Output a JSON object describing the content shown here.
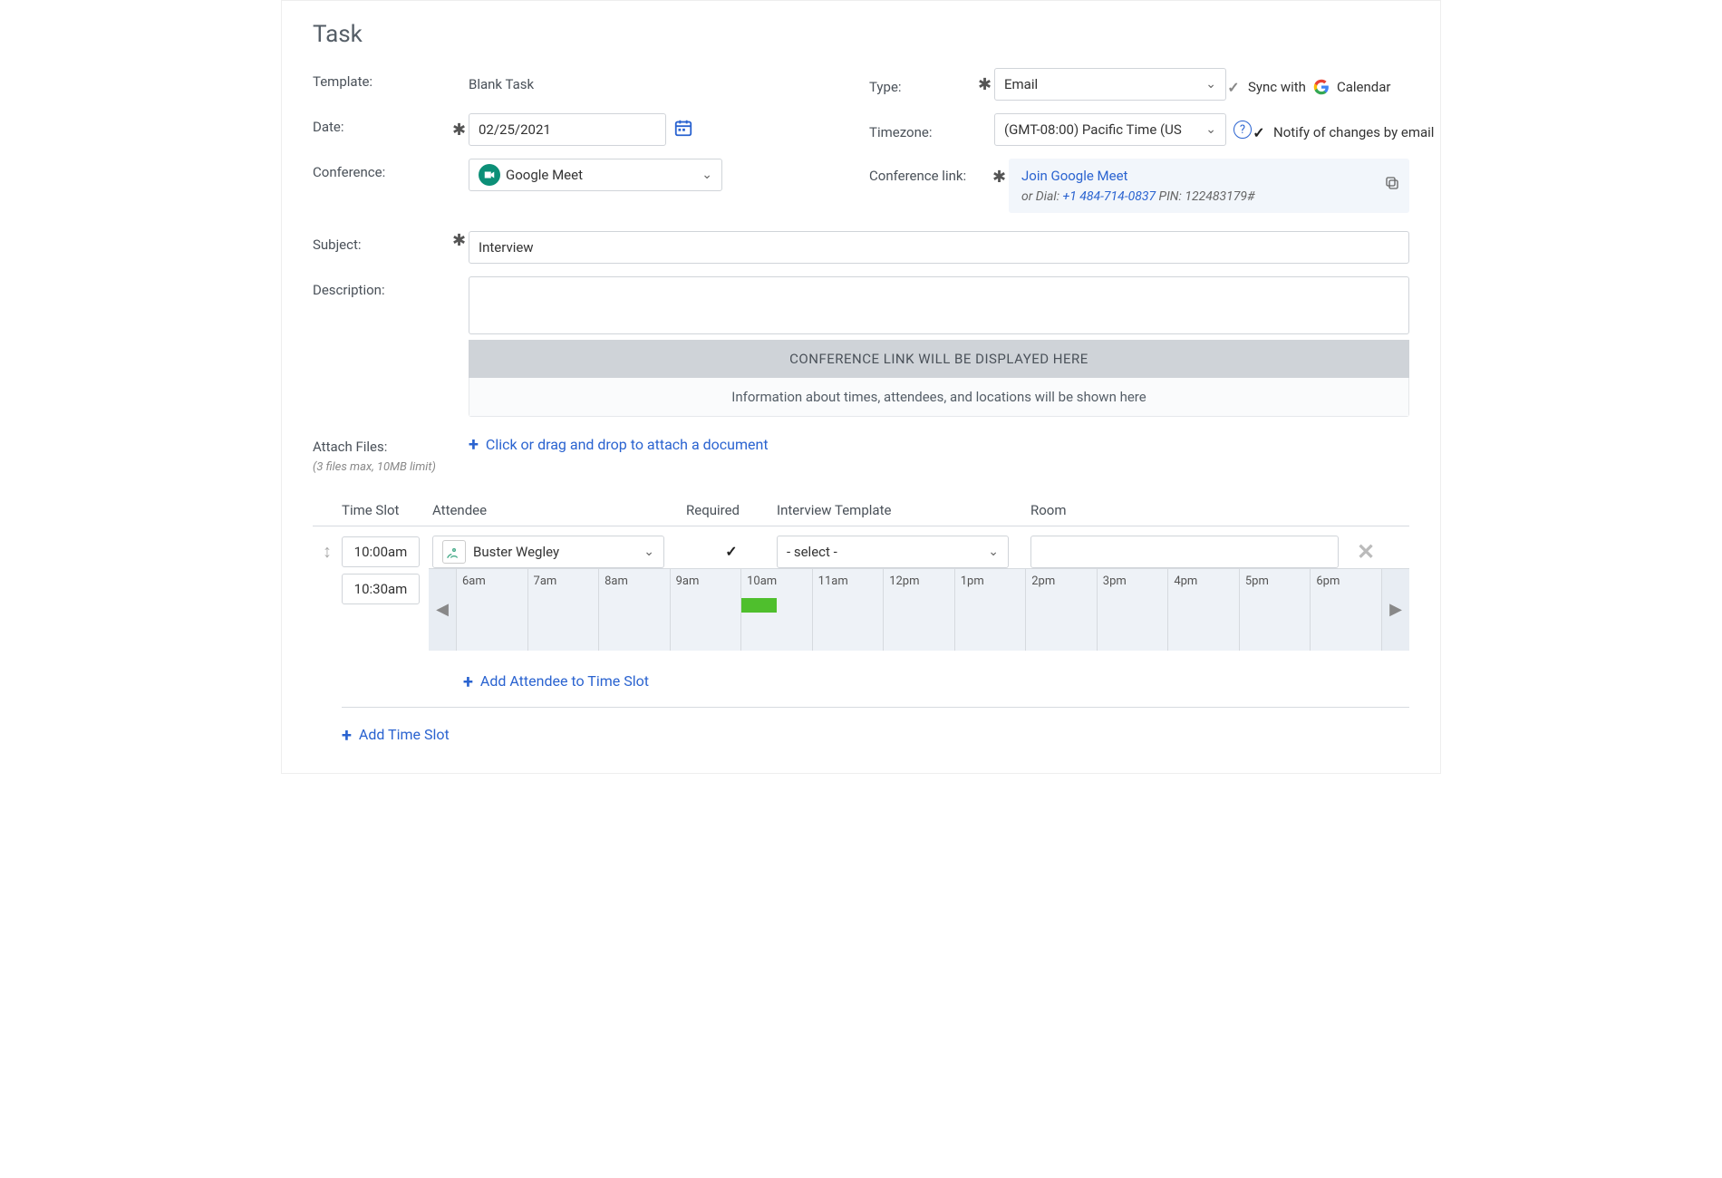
{
  "title": "Task",
  "labels": {
    "template": "Template:",
    "type": "Type:",
    "date": "Date:",
    "timezone": "Timezone:",
    "conference": "Conference:",
    "conference_link": "Conference link:",
    "subject": "Subject:",
    "description": "Description:",
    "attach": "Attach Files:",
    "attach_sub": "(3 files max,\n10MB limit)",
    "sync": "Sync with",
    "calendar": "Calendar",
    "notify": "Notify of changes by email"
  },
  "template_value": "Blank Task",
  "type_value": "Email",
  "date_value": "02/25/2021",
  "timezone_value": "(GMT-08:00) Pacific Time (US",
  "conference_value": "Google Meet",
  "conf_link": {
    "join": "Join Google Meet",
    "or_dial": "or Dial:",
    "phone": "+1 484-714-0837",
    "pin_label": "PIN:",
    "pin": "122483179#"
  },
  "subject_value": "Interview",
  "description_value": "",
  "banners": {
    "conf_placeholder": "CONFERENCE LINK WILL BE DISPLAYED HERE",
    "info_placeholder": "Information about times, attendees, and locations will be shown here"
  },
  "attach_cta": "Click or drag and drop to attach a document",
  "table": {
    "headers": {
      "time": "Time Slot",
      "attendee": "Attendee",
      "required": "Required",
      "template": "Interview Template",
      "room": "Room"
    },
    "slot": {
      "start": "10:00am",
      "end": "10:30am",
      "attendee": "Buster Wegley",
      "required": true,
      "template": "- select -",
      "room": ""
    },
    "timeline_hours": [
      "6am",
      "7am",
      "8am",
      "9am",
      "10am",
      "11am",
      "12pm",
      "1pm",
      "2pm",
      "3pm",
      "4pm",
      "5pm",
      "6pm"
    ],
    "add_attendee": "Add Attendee to Time Slot",
    "add_slot": "Add Time Slot"
  }
}
